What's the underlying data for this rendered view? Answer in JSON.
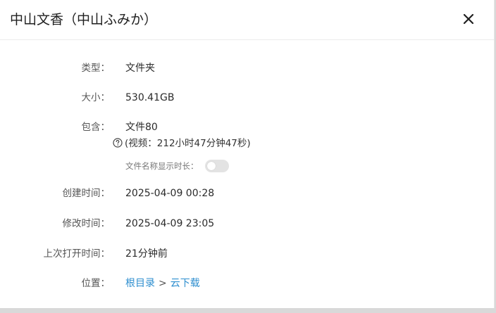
{
  "dialog": {
    "title": "中山文香（中山ふみか）",
    "close_icon": "close-icon"
  },
  "details": {
    "type": {
      "label": "类型：",
      "value": "文件夹"
    },
    "size": {
      "label": "大小：",
      "value": "530.41GB"
    },
    "contains": {
      "label": "包含：",
      "value": "文件80",
      "video_info": "(视频：212小时47分钟47秒)",
      "toggle_label": "文件名称显示时长：",
      "toggle_on": false
    },
    "created": {
      "label": "创建时间：",
      "value": "2025-04-09 00:28"
    },
    "modified": {
      "label": "修改时间：",
      "value": "2025-04-09 23:05"
    },
    "last_opened": {
      "label": "上次打开时间：",
      "value": "21分钟前"
    },
    "location": {
      "label": "位置：",
      "root": "根目录",
      "separator": ">",
      "folder": "云下载"
    }
  },
  "colors": {
    "link": "#2d8ecf",
    "label": "#555555",
    "value": "#2a2a2a"
  }
}
